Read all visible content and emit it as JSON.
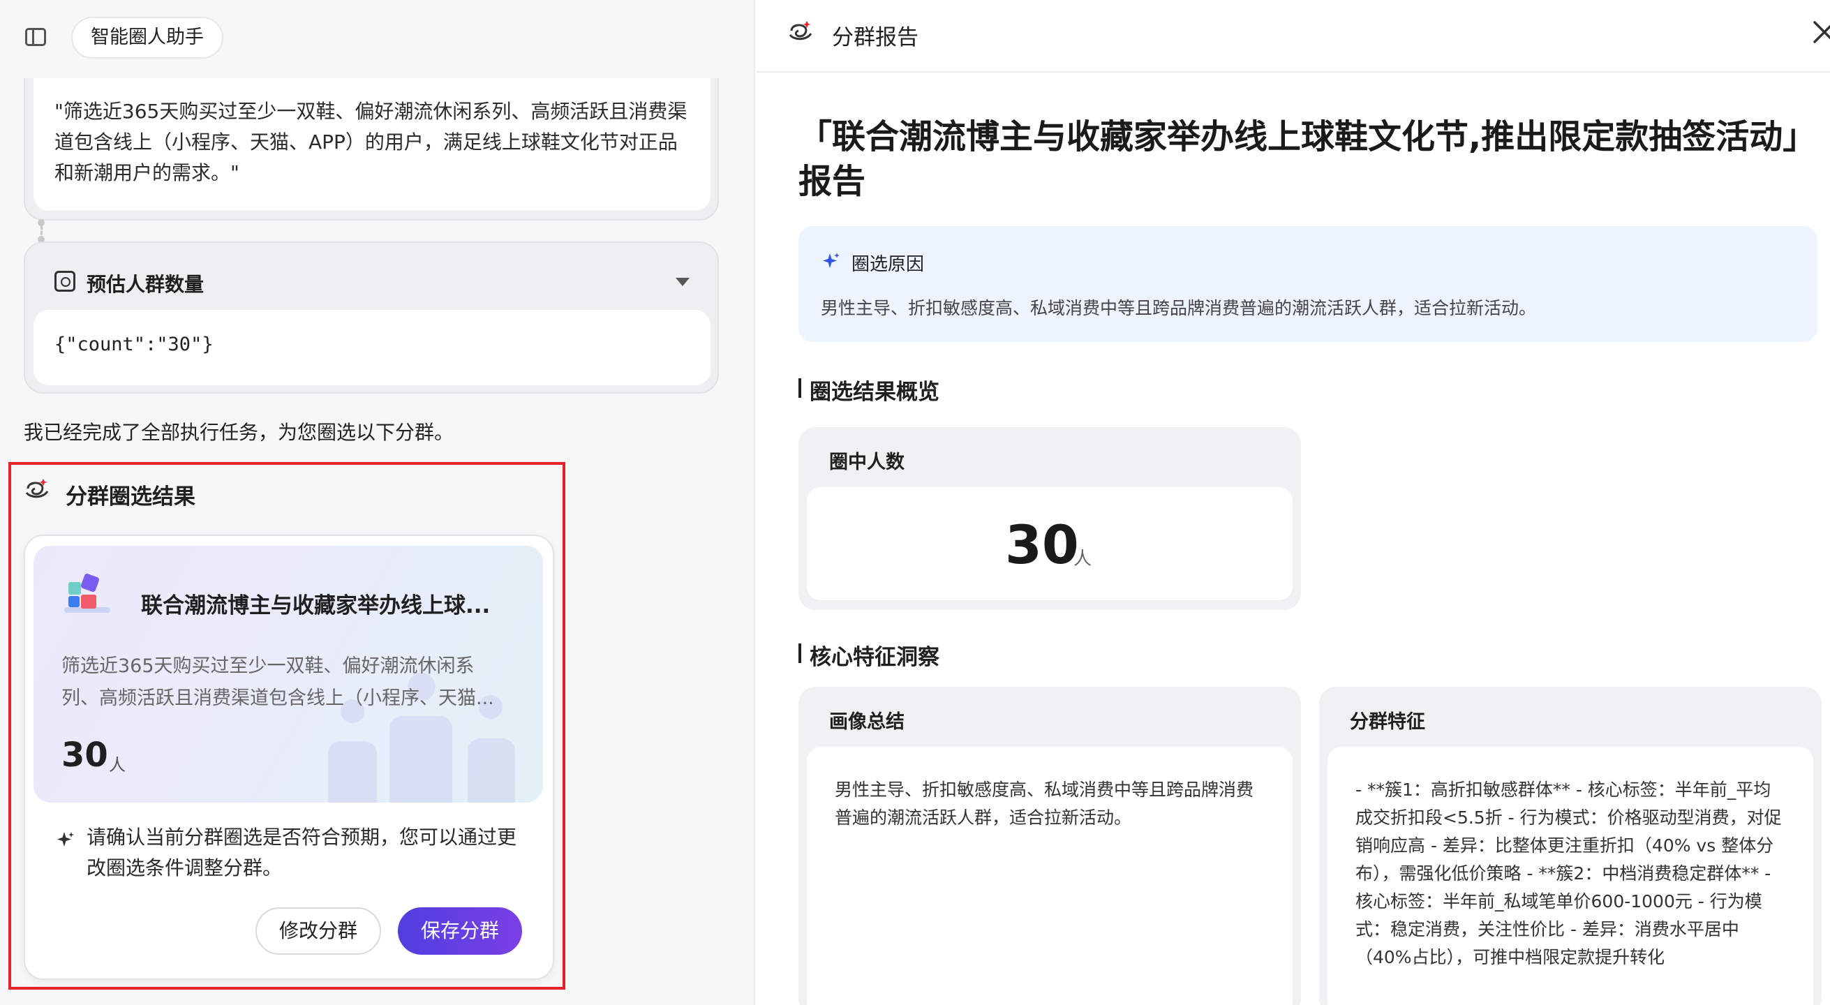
{
  "left_header": {
    "assistant_label": "智能圈人助手"
  },
  "query": {
    "text": "\"筛选近365天购买过至少一双鞋、偏好潮流休闲系列、高频活跃且消费渠道包含线上（小程序、天猫、APP）的用户，满足线上球鞋文化节对正品和新潮用户的需求。\""
  },
  "estimate": {
    "title": "预估人群数量",
    "output": "{\"count\":\"30\"}"
  },
  "done_message": "我已经完成了全部执行任务，为您圈选以下分群。",
  "result": {
    "title": "分群圈选结果",
    "segment_name": "联合潮流博主与收藏家举办线上球...",
    "segment_desc": "筛选近365天购买过至少一双鞋、偏好潮流休闲系列、高频活跃且消费渠道包含线上（小程序、天猫...",
    "count": "30",
    "unit": "人",
    "confirm_text": "请确认当前分群圈选是否符合预期，您可以通过更改圈选条件调整分群。",
    "modify_label": "修改分群",
    "save_label": "保存分群"
  },
  "report": {
    "header_title": "分群报告",
    "title": "「联合潮流博主与收藏家举办线上球鞋文化节,推出限定款抽签活动」报告",
    "reason_label": "圈选原因",
    "reason_text": "男性主导、折扣敏感度高、私域消费中等且跨品牌消费普遍的潮流活跃人群，适合拉新活动。",
    "overview_title": "圈选结果概览",
    "count_label": "圈中人数",
    "count": "30",
    "unit": "人",
    "insight_title": "核心特征洞察",
    "portrait_label": "画像总结",
    "portrait_text": "男性主导、折扣敏感度高、私域消费中等且跨品牌消费普遍的潮流活跃人群，适合拉新活动。",
    "features_label": "分群特征",
    "features_text": "- **簇1：高折扣敏感群体** - 核心标签：半年前_平均成交折扣段<5.5折 - 行为模式：价格驱动型消费，对促销响应高 - 差异：比整体更注重折扣（40% vs 整体分布），需强化低价策略 - **簇2：中档消费稳定群体** - 核心标签：半年前_私域笔单价600-1000元 - 行为模式：稳定消费，关注性价比 - 差异：消费水平居中（40%占比），可推中档限定款提升转化"
  },
  "colors": {
    "highlight_border": "#e4222a",
    "save_button_start": "#4f3fe0",
    "save_button_end": "#7b3fe4",
    "reason_bg": "#eef4ff",
    "sparkle_blue": "#2f54eb"
  },
  "icons": {
    "sidebar_toggle": "sidebar-toggle-icon",
    "estimate": "search-chart-icon",
    "dropdown": "chevron-down-icon",
    "result_header": "segment-swirl-icon",
    "segment_logo": "blocks-logo-icon",
    "confirm": "sparkle-icon",
    "report_header": "segment-swirl-icon",
    "close": "close-icon",
    "reason": "sparkle-icon"
  }
}
